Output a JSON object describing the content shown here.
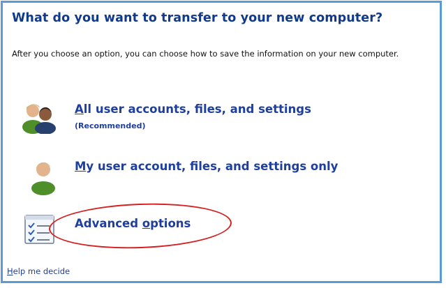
{
  "dialog": {
    "title": "What do you want to transfer to your new computer?",
    "description": "After you choose an option, you can choose how to save the information on your new computer."
  },
  "options": [
    {
      "label_first": "A",
      "label_rest": "ll user accounts, files, and settings",
      "sub": "(Recommended)",
      "icon": "two-users-icon"
    },
    {
      "label_first": "M",
      "label_rest": "y user account, files, and settings only",
      "icon": "user-icon"
    },
    {
      "label_before": "Advanced ",
      "label_u": "o",
      "label_after": "ptions",
      "icon": "checklist-icon"
    }
  ],
  "help": {
    "label_u": "H",
    "label_rest": "elp me decide"
  },
  "colors": {
    "frame": "#5b9bd5",
    "title": "#123a8a",
    "link": "#1e3f9e",
    "annotation": "#d42020"
  }
}
